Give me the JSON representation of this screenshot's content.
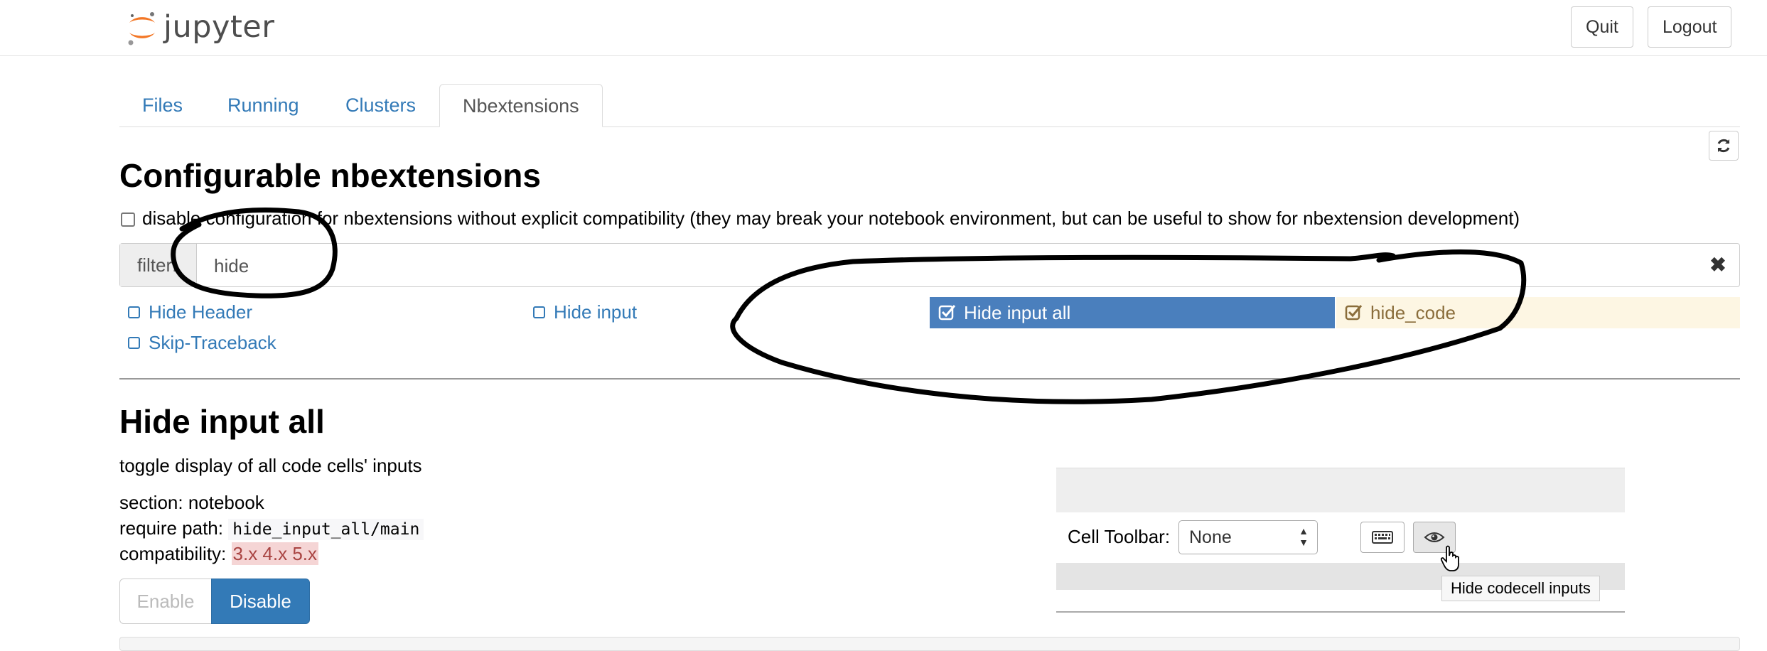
{
  "header": {
    "logo_text": "jupyter",
    "quit_label": "Quit",
    "logout_label": "Logout"
  },
  "tabs": [
    {
      "label": "Files"
    },
    {
      "label": "Running"
    },
    {
      "label": "Clusters"
    },
    {
      "label": "Nbextensions",
      "active": true
    }
  ],
  "main": {
    "title": "Configurable nbextensions",
    "disable_config_text": "disable configuration for nbextensions without explicit compatibility (they may break your notebook environment, but can be useful to show for nbextension development)",
    "filter": {
      "label": "filter:",
      "value": "hide",
      "clear_icon": "close-icon"
    },
    "extensions": [
      {
        "label": "Hide Header",
        "checked": false
      },
      {
        "label": "Hide input",
        "checked": false
      },
      {
        "label": "Hide input all",
        "checked": true,
        "selected": true
      },
      {
        "label": "hide_code",
        "checked": true
      },
      {
        "label": "Skip-Traceback",
        "checked": false
      }
    ]
  },
  "detail": {
    "title": "Hide input all",
    "description": "toggle display of all code cells' inputs",
    "section_label": "section: notebook",
    "require_path_label": "require path:",
    "require_path_value": "hide_input_all/main",
    "compatibility_label": "compatibility:",
    "compatibility_value": "3.x 4.x 5.x",
    "enable_label": "Enable",
    "disable_label": "Disable"
  },
  "preview": {
    "toolbar_label": "Cell Toolbar:",
    "select_value": "None",
    "keyboard_icon": "keyboard-icon",
    "eye_icon": "eye-icon",
    "tooltip": "Hide codecell inputs"
  },
  "colors": {
    "link": "#337ab7",
    "selected_bg": "#4a7fbd",
    "warning_bg": "#fdf6e3",
    "jupyter_orange": "#f37726"
  }
}
